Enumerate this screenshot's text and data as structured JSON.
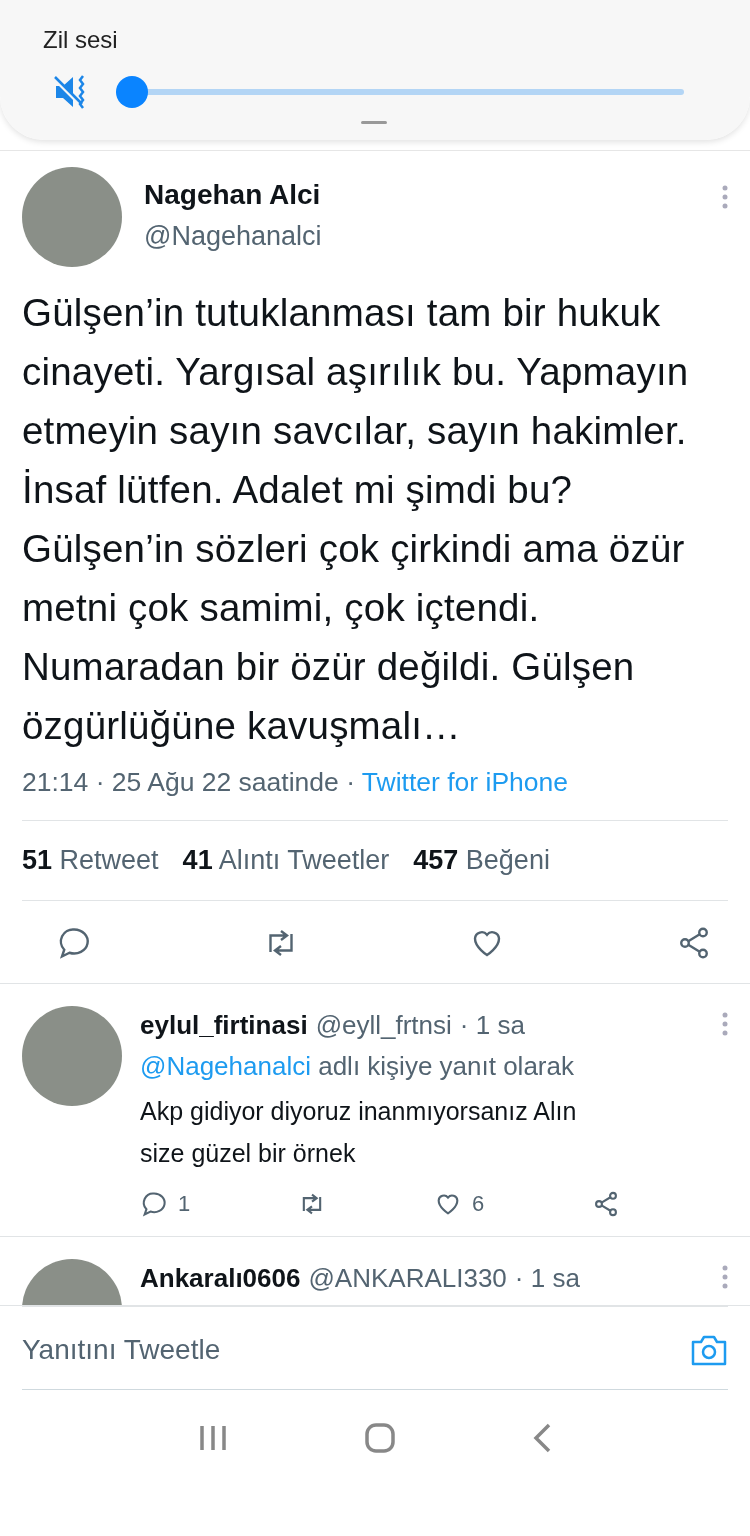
{
  "volume_panel": {
    "label": "Zil sesi",
    "muted": true,
    "level": 0
  },
  "tweet": {
    "name": "Nagehan Alci",
    "handle": "@Nagehanalci",
    "text": "Gülşen’in tutuklanması tam bir hukuk cinayeti. Yargısal aşırılık bu. Yapmayın etmeyin sayın savcılar, sayın hakimler. İnsaf lütfen. Adalet mi şimdi bu?Gülşen’in sözleri çok çirkindi ama özür metni çok samimi, çok içtendi. Numaradan bir özür değildi. Gülşen özgürlüğüne kavuşmalı…",
    "meta": "21:14 · 25 Ağu 22 saatinde · ",
    "source": "Twitter for iPhone",
    "stats": [
      {
        "count": "51",
        "label": "Retweet"
      },
      {
        "count": "41",
        "label": "Alıntı Tweetler"
      },
      {
        "count": "457",
        "label": "Beğeni"
      }
    ]
  },
  "replies": [
    {
      "name": "eylul_firtinasi",
      "handle": "@eyll_frtnsi",
      "time": "· 1 sa",
      "reply_to": "@Nagehanalci",
      "reply_suffix": "adlı kişiye yanıt olarak",
      "text": "Akp gidiyor diyoruz inanmıyorsanız Alın size güzel bir örnek",
      "reply_count": "1",
      "like_count": "6"
    },
    {
      "name": "Ankaralı0606",
      "handle": "@ANKARALI330",
      "time": "· 1 sa"
    }
  ],
  "composer": {
    "placeholder": "Yanıtını Tweetle"
  }
}
